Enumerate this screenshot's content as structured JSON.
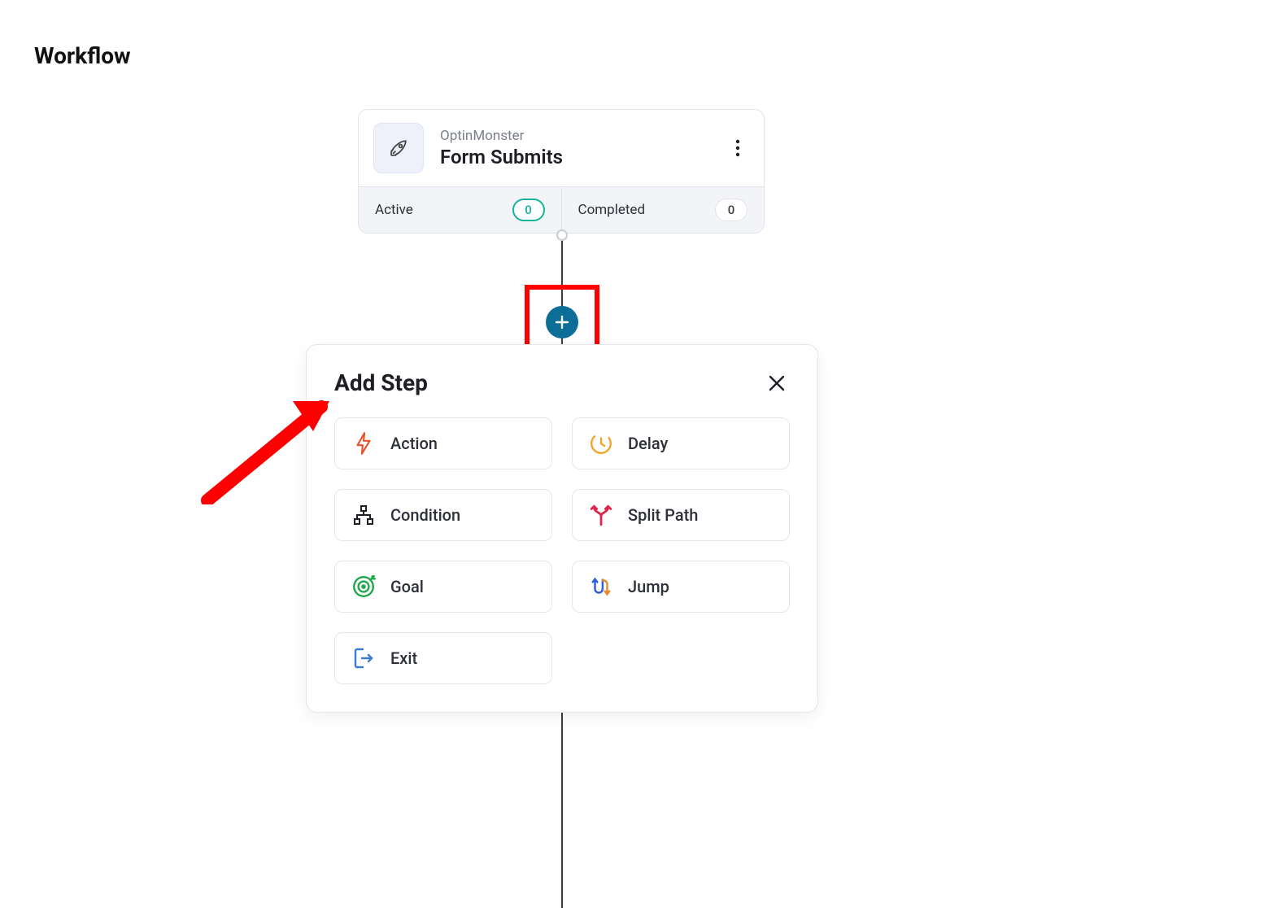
{
  "page_title": "Workflow",
  "trigger": {
    "source": "OptinMonster",
    "event": "Form Submits",
    "stats": {
      "active": {
        "label": "Active",
        "value": "0"
      },
      "completed": {
        "label": "Completed",
        "value": "0"
      }
    }
  },
  "popover": {
    "title": "Add Step",
    "options": [
      {
        "key": "action",
        "label": "Action",
        "icon": "lightning-icon",
        "color": "#e3542a"
      },
      {
        "key": "delay",
        "label": "Delay",
        "icon": "clock-icon",
        "color": "#f0a42b"
      },
      {
        "key": "condition",
        "label": "Condition",
        "icon": "hierarchy-icon",
        "color": "#1d1f24"
      },
      {
        "key": "split",
        "label": "Split Path",
        "icon": "split-icon",
        "color": "#e0234a"
      },
      {
        "key": "goal",
        "label": "Goal",
        "icon": "target-icon",
        "color": "#1fa64a"
      },
      {
        "key": "jump",
        "label": "Jump",
        "icon": "jump-icon",
        "color": "#2e5fd8"
      },
      {
        "key": "exit",
        "label": "Exit",
        "icon": "exit-icon",
        "color": "#3b7ed0"
      }
    ]
  }
}
